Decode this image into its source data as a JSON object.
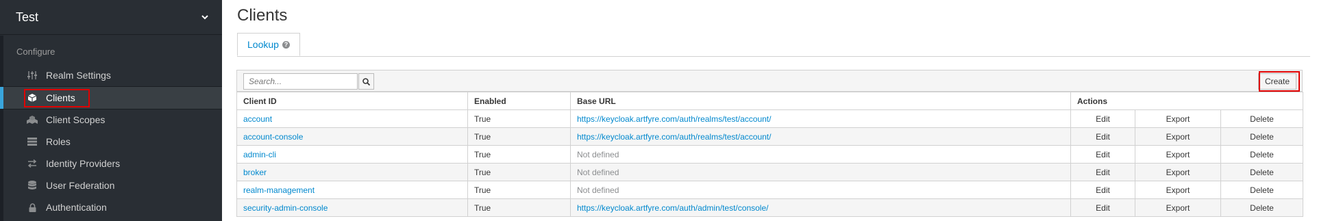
{
  "realm": {
    "name": "Test"
  },
  "sidebar": {
    "section": "Configure",
    "items": [
      {
        "label": "Realm Settings",
        "icon": "sliders-icon"
      },
      {
        "label": "Clients",
        "icon": "cube-icon",
        "active": true
      },
      {
        "label": "Client Scopes",
        "icon": "cubes-icon"
      },
      {
        "label": "Roles",
        "icon": "list-icon"
      },
      {
        "label": "Identity Providers",
        "icon": "exchange-icon"
      },
      {
        "label": "User Federation",
        "icon": "database-icon"
      },
      {
        "label": "Authentication",
        "icon": "lock-icon"
      }
    ]
  },
  "page": {
    "title": "Clients"
  },
  "tabs": [
    {
      "label": "Lookup"
    }
  ],
  "toolbar": {
    "search_placeholder": "Search...",
    "create_label": "Create"
  },
  "table": {
    "headers": [
      "Client ID",
      "Enabled",
      "Base URL",
      "Actions"
    ],
    "action_labels": [
      "Edit",
      "Export",
      "Delete"
    ],
    "rows": [
      {
        "client_id": "account",
        "enabled": "True",
        "base_url": "https://keycloak.artfyre.com/auth/realms/test/account/"
      },
      {
        "client_id": "account-console",
        "enabled": "True",
        "base_url": "https://keycloak.artfyre.com/auth/realms/test/account/"
      },
      {
        "client_id": "admin-cli",
        "enabled": "True",
        "base_url": "Not defined"
      },
      {
        "client_id": "broker",
        "enabled": "True",
        "base_url": "Not defined"
      },
      {
        "client_id": "realm-management",
        "enabled": "True",
        "base_url": "Not defined"
      },
      {
        "client_id": "security-admin-console",
        "enabled": "True",
        "base_url": "https://keycloak.artfyre.com/auth/admin/test/console/"
      }
    ]
  },
  "colors": {
    "accent": "#0088ce",
    "sidebar_bg": "#292e34",
    "active_bar": "#39a5dc",
    "highlight": "#e00000"
  }
}
